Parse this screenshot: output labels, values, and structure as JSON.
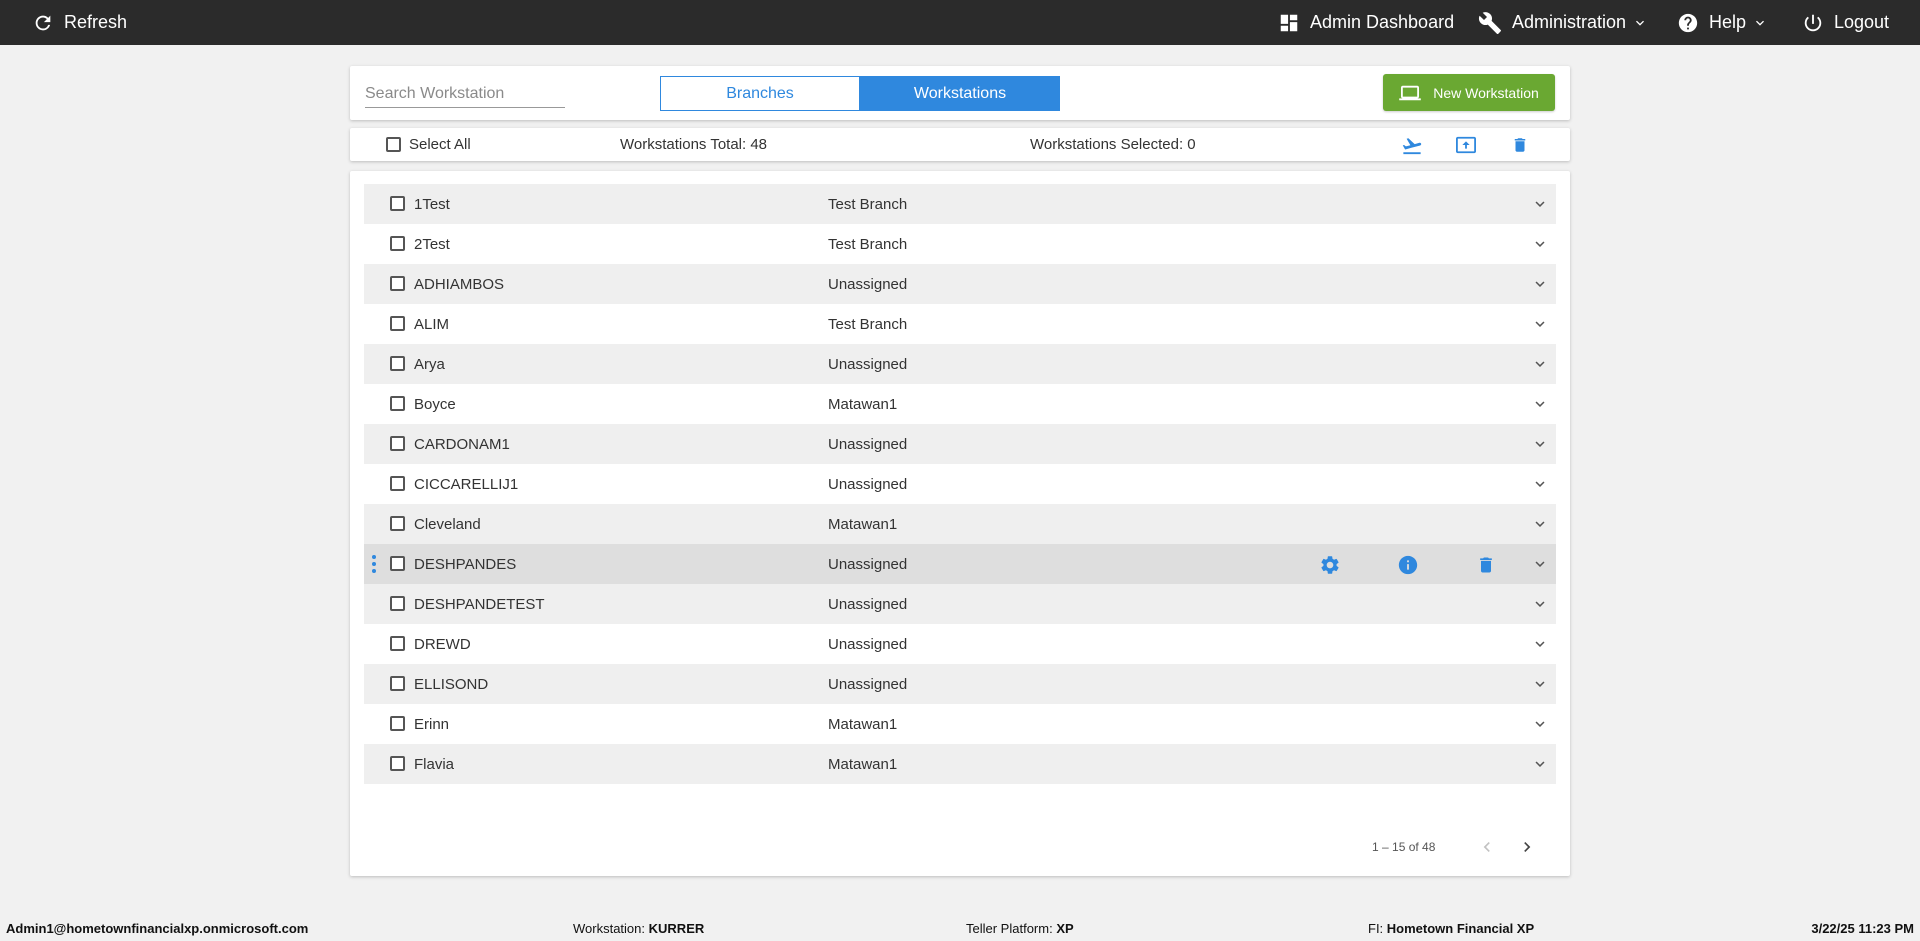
{
  "topbar": {
    "refresh_label": "Refresh",
    "admin_dashboard_label": "Admin Dashboard",
    "administration_label": "Administration",
    "help_label": "Help",
    "logout_label": "Logout"
  },
  "search": {
    "placeholder": "Search Workstation",
    "value": ""
  },
  "segments": {
    "branches": "Branches",
    "workstations": "Workstations",
    "selected": "Workstations"
  },
  "new_workstation_label": "New Workstation",
  "toolbar": {
    "select_all_label": "Select All",
    "total_text": "Workstations Total: 48",
    "selected_text": "Workstations Selected: 0"
  },
  "rows": [
    {
      "name": "1Test",
      "branch": "Test Branch"
    },
    {
      "name": "2Test",
      "branch": "Test Branch"
    },
    {
      "name": "ADHIAMBOS",
      "branch": "Unassigned"
    },
    {
      "name": "ALIM",
      "branch": "Test Branch"
    },
    {
      "name": "Arya",
      "branch": "Unassigned"
    },
    {
      "name": "Boyce",
      "branch": "Matawan1"
    },
    {
      "name": "CARDONAM1",
      "branch": "Unassigned"
    },
    {
      "name": "CICCARELLIJ1",
      "branch": "Unassigned"
    },
    {
      "name": "Cleveland",
      "branch": "Matawan1"
    },
    {
      "name": "DESHPANDES",
      "branch": "Unassigned",
      "hovered": true
    },
    {
      "name": "DESHPANDETEST",
      "branch": "Unassigned"
    },
    {
      "name": "DREWD",
      "branch": "Unassigned"
    },
    {
      "name": "ELLISOND",
      "branch": "Unassigned"
    },
    {
      "name": "Erinn",
      "branch": "Matawan1"
    },
    {
      "name": "Flavia",
      "branch": "Matawan1"
    }
  ],
  "pager": {
    "range_text": "1 – 15 of 48"
  },
  "footer": {
    "user": "Admin1@hometownfinancialxp.onmicrosoft.com",
    "workstation_label": "Workstation:",
    "workstation_value": "KURRER",
    "platform_label": "Teller Platform:",
    "platform_value": "XP",
    "fi_label": "FI:",
    "fi_value": "Hometown Financial XP",
    "datetime": "3/22/25 11:23 PM"
  },
  "colors": {
    "accent": "#2f88de",
    "success": "#6aa832",
    "topbar": "#2b2b2b"
  }
}
